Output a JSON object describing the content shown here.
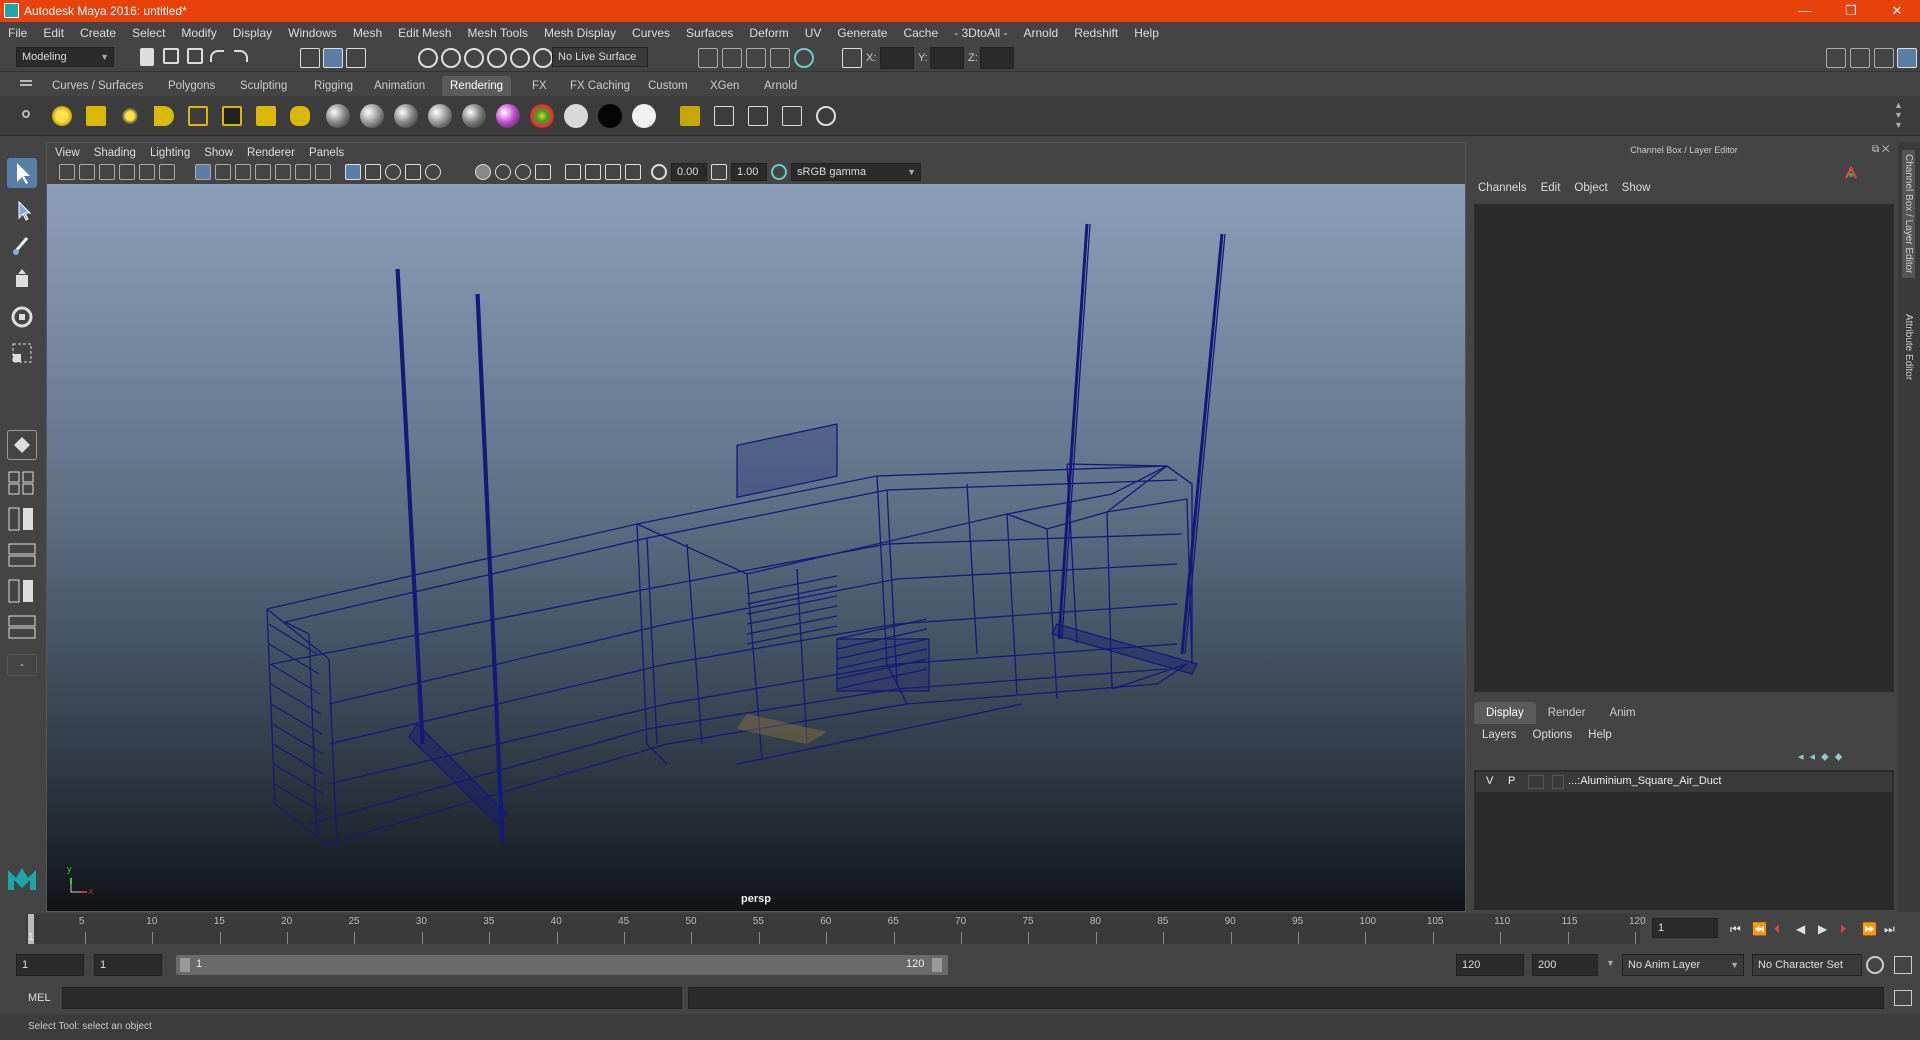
{
  "titlebar": {
    "title": "Autodesk Maya 2016: untitled*",
    "minimize": "—",
    "restore": "❐",
    "close": "✕"
  },
  "menubar": [
    "File",
    "Edit",
    "Create",
    "Select",
    "Modify",
    "Display",
    "Windows",
    "Mesh",
    "Edit Mesh",
    "Mesh Tools",
    "Mesh Display",
    "Curves",
    "Surfaces",
    "Deform",
    "UV",
    "Generate",
    "Cache",
    "- 3DtoAll -",
    "Arnold",
    "Redshift",
    "Help"
  ],
  "statusline": {
    "mode": "Modeling",
    "live_surface": "No Live Surface",
    "x_label": "X:",
    "y_label": "Y:",
    "z_label": "Z:"
  },
  "shelf_tabs": [
    "Curves / Surfaces",
    "Polygons",
    "Sculpting",
    "Rigging",
    "Animation",
    "Rendering",
    "FX",
    "FX Caching",
    "Custom",
    "XGen",
    "Arnold"
  ],
  "shelf_active": "Rendering",
  "shelf_spheres": [
    "#8a8a8a",
    "#9a9a9a",
    "#888888",
    "#9b9b9b",
    "#7f7f7f",
    "#c84cd0",
    "#e53a2a",
    "#d9d9d9",
    "#050505",
    "#f0f0f0"
  ],
  "viewport": {
    "menu": [
      "View",
      "Shading",
      "Lighting",
      "Show",
      "Renderer",
      "Panels"
    ],
    "exposure": "0.00",
    "gamma": "1.00",
    "colorspace": "sRGB gamma",
    "camera": "persp"
  },
  "channelbox": {
    "header": "Channel Box / Layer Editor",
    "menu": [
      "Channels",
      "Edit",
      "Object",
      "Show"
    ]
  },
  "layereditor": {
    "tabs": [
      "Display",
      "Render",
      "Anim"
    ],
    "active": "Display",
    "menu": [
      "Layers",
      "Options",
      "Help"
    ],
    "layers": [
      {
        "v": "V",
        "p": "P",
        "name": "...:Aluminium_Square_Air_Duct"
      }
    ]
  },
  "sidetabs": [
    "Channel Box / Layer Editor",
    "Attribute Editor"
  ],
  "timeline": {
    "labels": [
      "5",
      "10",
      "15",
      "20",
      "25",
      "30",
      "35",
      "40",
      "45",
      "50",
      "55",
      "60",
      "65",
      "70",
      "75",
      "80",
      "85",
      "90",
      "95",
      "100",
      "105",
      "110",
      "115",
      "120"
    ],
    "start_label": "1",
    "current_frame": "1"
  },
  "range": {
    "start": "1",
    "playback_start": "1",
    "slider_start": "1",
    "slider_end": "120",
    "playback_end": "120",
    "end": "200",
    "anim_layer": "No Anim Layer",
    "char_set": "No Character Set"
  },
  "cmdline": {
    "lang": "MEL"
  },
  "helpline": {
    "text": "Select Tool: select an object"
  },
  "axis": {
    "y": "y",
    "x": "x"
  }
}
